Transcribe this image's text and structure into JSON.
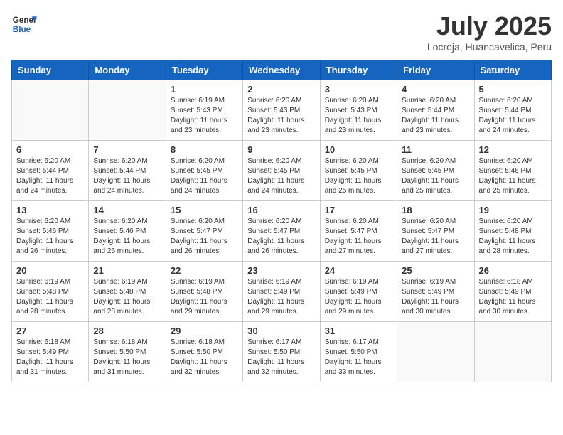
{
  "header": {
    "logo_line1": "General",
    "logo_line2": "Blue",
    "month_year": "July 2025",
    "location": "Locroja, Huancavelica, Peru"
  },
  "days_of_week": [
    "Sunday",
    "Monday",
    "Tuesday",
    "Wednesday",
    "Thursday",
    "Friday",
    "Saturday"
  ],
  "weeks": [
    [
      {
        "day": "",
        "sunrise": "",
        "sunset": "",
        "daylight": ""
      },
      {
        "day": "",
        "sunrise": "",
        "sunset": "",
        "daylight": ""
      },
      {
        "day": "1",
        "sunrise": "Sunrise: 6:19 AM",
        "sunset": "Sunset: 5:43 PM",
        "daylight": "Daylight: 11 hours and 23 minutes."
      },
      {
        "day": "2",
        "sunrise": "Sunrise: 6:20 AM",
        "sunset": "Sunset: 5:43 PM",
        "daylight": "Daylight: 11 hours and 23 minutes."
      },
      {
        "day": "3",
        "sunrise": "Sunrise: 6:20 AM",
        "sunset": "Sunset: 5:43 PM",
        "daylight": "Daylight: 11 hours and 23 minutes."
      },
      {
        "day": "4",
        "sunrise": "Sunrise: 6:20 AM",
        "sunset": "Sunset: 5:44 PM",
        "daylight": "Daylight: 11 hours and 23 minutes."
      },
      {
        "day": "5",
        "sunrise": "Sunrise: 6:20 AM",
        "sunset": "Sunset: 5:44 PM",
        "daylight": "Daylight: 11 hours and 24 minutes."
      }
    ],
    [
      {
        "day": "6",
        "sunrise": "Sunrise: 6:20 AM",
        "sunset": "Sunset: 5:44 PM",
        "daylight": "Daylight: 11 hours and 24 minutes."
      },
      {
        "day": "7",
        "sunrise": "Sunrise: 6:20 AM",
        "sunset": "Sunset: 5:44 PM",
        "daylight": "Daylight: 11 hours and 24 minutes."
      },
      {
        "day": "8",
        "sunrise": "Sunrise: 6:20 AM",
        "sunset": "Sunset: 5:45 PM",
        "daylight": "Daylight: 11 hours and 24 minutes."
      },
      {
        "day": "9",
        "sunrise": "Sunrise: 6:20 AM",
        "sunset": "Sunset: 5:45 PM",
        "daylight": "Daylight: 11 hours and 24 minutes."
      },
      {
        "day": "10",
        "sunrise": "Sunrise: 6:20 AM",
        "sunset": "Sunset: 5:45 PM",
        "daylight": "Daylight: 11 hours and 25 minutes."
      },
      {
        "day": "11",
        "sunrise": "Sunrise: 6:20 AM",
        "sunset": "Sunset: 5:45 PM",
        "daylight": "Daylight: 11 hours and 25 minutes."
      },
      {
        "day": "12",
        "sunrise": "Sunrise: 6:20 AM",
        "sunset": "Sunset: 5:46 PM",
        "daylight": "Daylight: 11 hours and 25 minutes."
      }
    ],
    [
      {
        "day": "13",
        "sunrise": "Sunrise: 6:20 AM",
        "sunset": "Sunset: 5:46 PM",
        "daylight": "Daylight: 11 hours and 26 minutes."
      },
      {
        "day": "14",
        "sunrise": "Sunrise: 6:20 AM",
        "sunset": "Sunset: 5:46 PM",
        "daylight": "Daylight: 11 hours and 26 minutes."
      },
      {
        "day": "15",
        "sunrise": "Sunrise: 6:20 AM",
        "sunset": "Sunset: 5:47 PM",
        "daylight": "Daylight: 11 hours and 26 minutes."
      },
      {
        "day": "16",
        "sunrise": "Sunrise: 6:20 AM",
        "sunset": "Sunset: 5:47 PM",
        "daylight": "Daylight: 11 hours and 26 minutes."
      },
      {
        "day": "17",
        "sunrise": "Sunrise: 6:20 AM",
        "sunset": "Sunset: 5:47 PM",
        "daylight": "Daylight: 11 hours and 27 minutes."
      },
      {
        "day": "18",
        "sunrise": "Sunrise: 6:20 AM",
        "sunset": "Sunset: 5:47 PM",
        "daylight": "Daylight: 11 hours and 27 minutes."
      },
      {
        "day": "19",
        "sunrise": "Sunrise: 6:20 AM",
        "sunset": "Sunset: 5:48 PM",
        "daylight": "Daylight: 11 hours and 28 minutes."
      }
    ],
    [
      {
        "day": "20",
        "sunrise": "Sunrise: 6:19 AM",
        "sunset": "Sunset: 5:48 PM",
        "daylight": "Daylight: 11 hours and 28 minutes."
      },
      {
        "day": "21",
        "sunrise": "Sunrise: 6:19 AM",
        "sunset": "Sunset: 5:48 PM",
        "daylight": "Daylight: 11 hours and 28 minutes."
      },
      {
        "day": "22",
        "sunrise": "Sunrise: 6:19 AM",
        "sunset": "Sunset: 5:48 PM",
        "daylight": "Daylight: 11 hours and 29 minutes."
      },
      {
        "day": "23",
        "sunrise": "Sunrise: 6:19 AM",
        "sunset": "Sunset: 5:49 PM",
        "daylight": "Daylight: 11 hours and 29 minutes."
      },
      {
        "day": "24",
        "sunrise": "Sunrise: 6:19 AM",
        "sunset": "Sunset: 5:49 PM",
        "daylight": "Daylight: 11 hours and 29 minutes."
      },
      {
        "day": "25",
        "sunrise": "Sunrise: 6:19 AM",
        "sunset": "Sunset: 5:49 PM",
        "daylight": "Daylight: 11 hours and 30 minutes."
      },
      {
        "day": "26",
        "sunrise": "Sunrise: 6:18 AM",
        "sunset": "Sunset: 5:49 PM",
        "daylight": "Daylight: 11 hours and 30 minutes."
      }
    ],
    [
      {
        "day": "27",
        "sunrise": "Sunrise: 6:18 AM",
        "sunset": "Sunset: 5:49 PM",
        "daylight": "Daylight: 11 hours and 31 minutes."
      },
      {
        "day": "28",
        "sunrise": "Sunrise: 6:18 AM",
        "sunset": "Sunset: 5:50 PM",
        "daylight": "Daylight: 11 hours and 31 minutes."
      },
      {
        "day": "29",
        "sunrise": "Sunrise: 6:18 AM",
        "sunset": "Sunset: 5:50 PM",
        "daylight": "Daylight: 11 hours and 32 minutes."
      },
      {
        "day": "30",
        "sunrise": "Sunrise: 6:17 AM",
        "sunset": "Sunset: 5:50 PM",
        "daylight": "Daylight: 11 hours and 32 minutes."
      },
      {
        "day": "31",
        "sunrise": "Sunrise: 6:17 AM",
        "sunset": "Sunset: 5:50 PM",
        "daylight": "Daylight: 11 hours and 33 minutes."
      },
      {
        "day": "",
        "sunrise": "",
        "sunset": "",
        "daylight": ""
      },
      {
        "day": "",
        "sunrise": "",
        "sunset": "",
        "daylight": ""
      }
    ]
  ]
}
